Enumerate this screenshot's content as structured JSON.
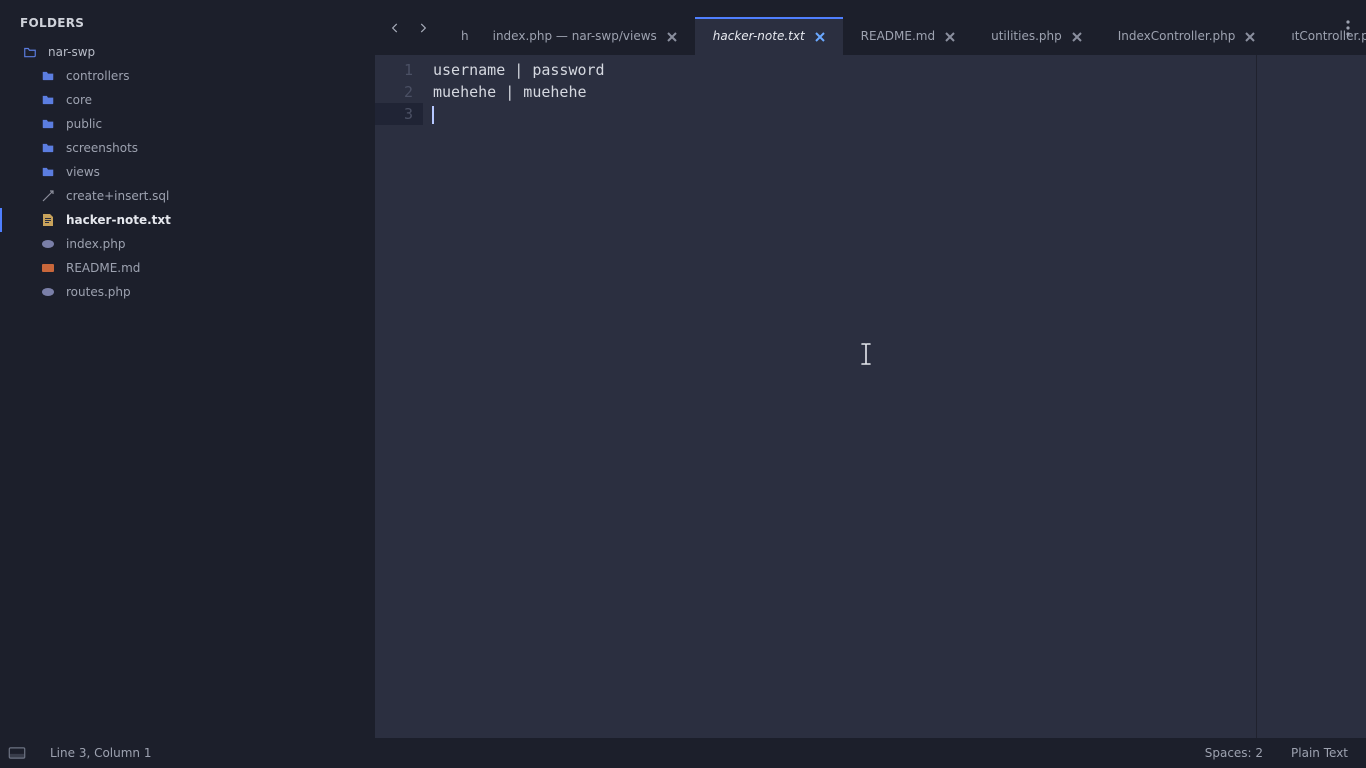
{
  "sidebar": {
    "title": "FOLDERS",
    "root": "nar-swp",
    "folders": [
      "controllers",
      "core",
      "public",
      "screenshots",
      "views"
    ],
    "files": [
      {
        "name": "create+insert.sql",
        "type": "sql"
      },
      {
        "name": "hacker-note.txt",
        "type": "txt",
        "active": true
      },
      {
        "name": "index.php",
        "type": "php"
      },
      {
        "name": "README.md",
        "type": "md"
      },
      {
        "name": "routes.php",
        "type": "php"
      }
    ]
  },
  "tabs": {
    "truncated_prefix": "h",
    "items": [
      {
        "label": "index.php — nar-swp/views"
      },
      {
        "label": "hacker-note.txt",
        "active": true
      },
      {
        "label": "README.md"
      },
      {
        "label": "utilities.php"
      },
      {
        "label": "IndexController.php"
      },
      {
        "label": "ıtController.php"
      }
    ]
  },
  "editor": {
    "lines": [
      "username | password",
      "muehehe | muehehe",
      ""
    ],
    "current_line_index": 2
  },
  "statusbar": {
    "position": "Line 3, Column 1",
    "indent": "Spaces: 2",
    "syntax": "Plain Text"
  }
}
